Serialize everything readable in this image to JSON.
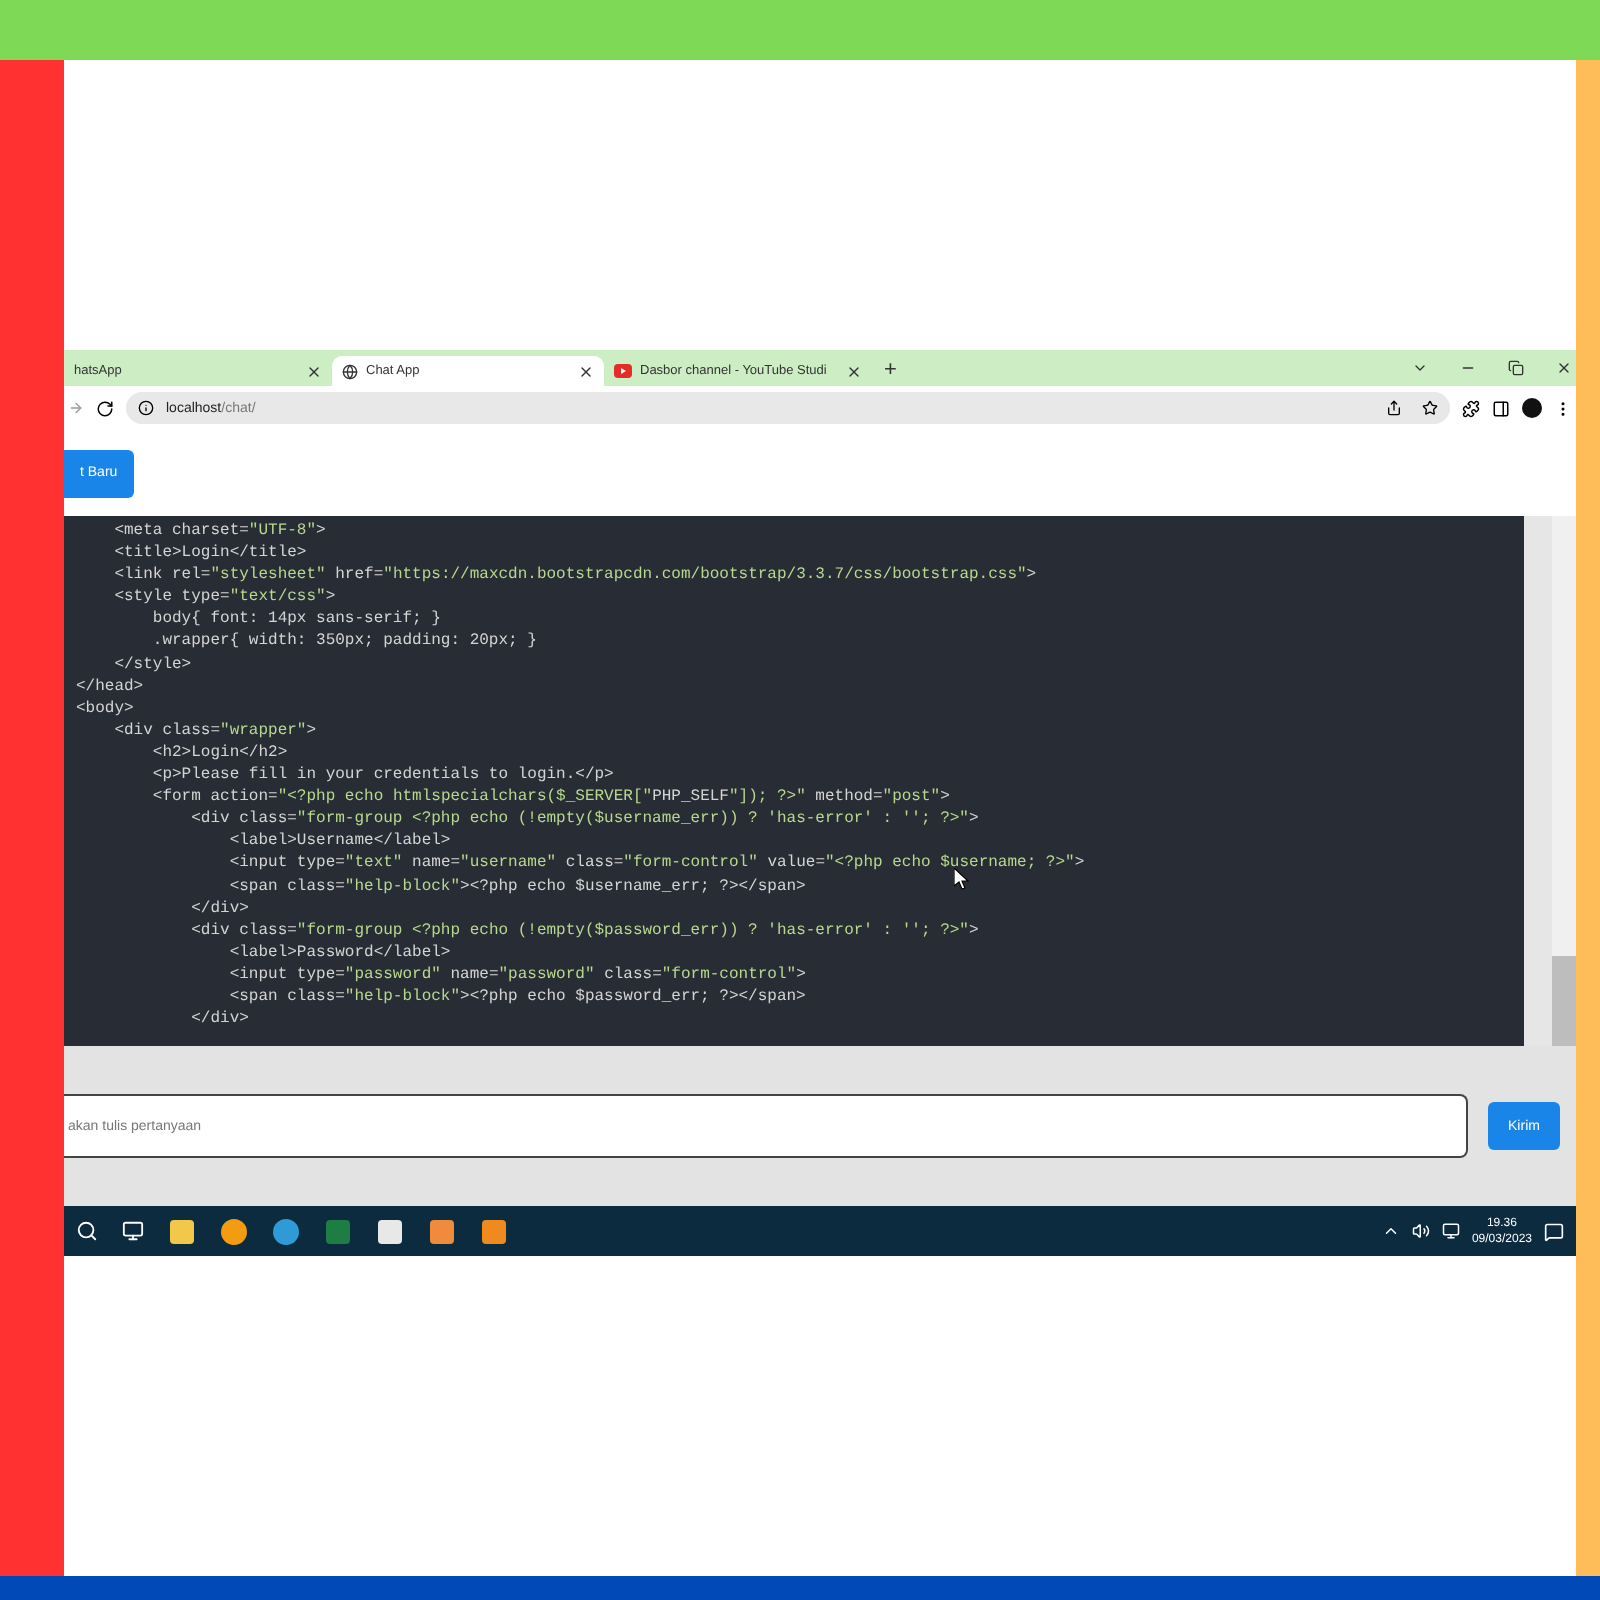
{
  "browser": {
    "tabs": [
      {
        "title": "hatsApp",
        "selected": false
      },
      {
        "title": "Chat App",
        "selected": true,
        "kind": "globe"
      },
      {
        "title": "Dasbor channel - YouTube Studi",
        "selected": false,
        "kind": "video"
      }
    ],
    "new_tab": "+",
    "address": {
      "host": "localhost",
      "path": "/chat/"
    }
  },
  "page": {
    "new_chat_button": "t Baru",
    "code_lines": [
      "    <meta charset=\"UTF-8\">",
      "    <title>Login</title>",
      "    <link rel=\"stylesheet\" href=\"https://maxcdn.bootstrapcdn.com/bootstrap/3.3.7/css/bootstrap.css\">",
      "    <style type=\"text/css\">",
      "        body{ font: 14px sans-serif; }",
      "        .wrapper{ width: 350px; padding: 20px; }",
      "    </style>",
      "</head>",
      "<body>",
      "    <div class=\"wrapper\">",
      "        <h2>Login</h2>",
      "        <p>Please fill in your credentials to login.</p>",
      "        <form action=\"<?php echo htmlspecialchars($_SERVER[\"PHP_SELF\"]); ?>\" method=\"post\">",
      "            <div class=\"form-group <?php echo (!empty($username_err)) ? 'has-error' : ''; ?>\">",
      "                <label>Username</label>",
      "                <input type=\"text\" name=\"username\" class=\"form-control\" value=\"<?php echo $username; ?>\">",
      "                <span class=\"help-block\"><?php echo $username_err; ?></span>",
      "            </div>",
      "            <div class=\"form-group <?php echo (!empty($password_err)) ? 'has-error' : ''; ?>\">",
      "                <label>Password</label>",
      "                <input type=\"password\" name=\"password\" class=\"form-control\">",
      "                <span class=\"help-block\"><?php echo $password_err; ?></span>",
      "            </div>"
    ],
    "question_input": {
      "placeholder": "akan tulis pertanyaan"
    },
    "send_button": "Kirim"
  },
  "taskbar": {
    "time": "19.36",
    "date": "09/03/2023"
  }
}
